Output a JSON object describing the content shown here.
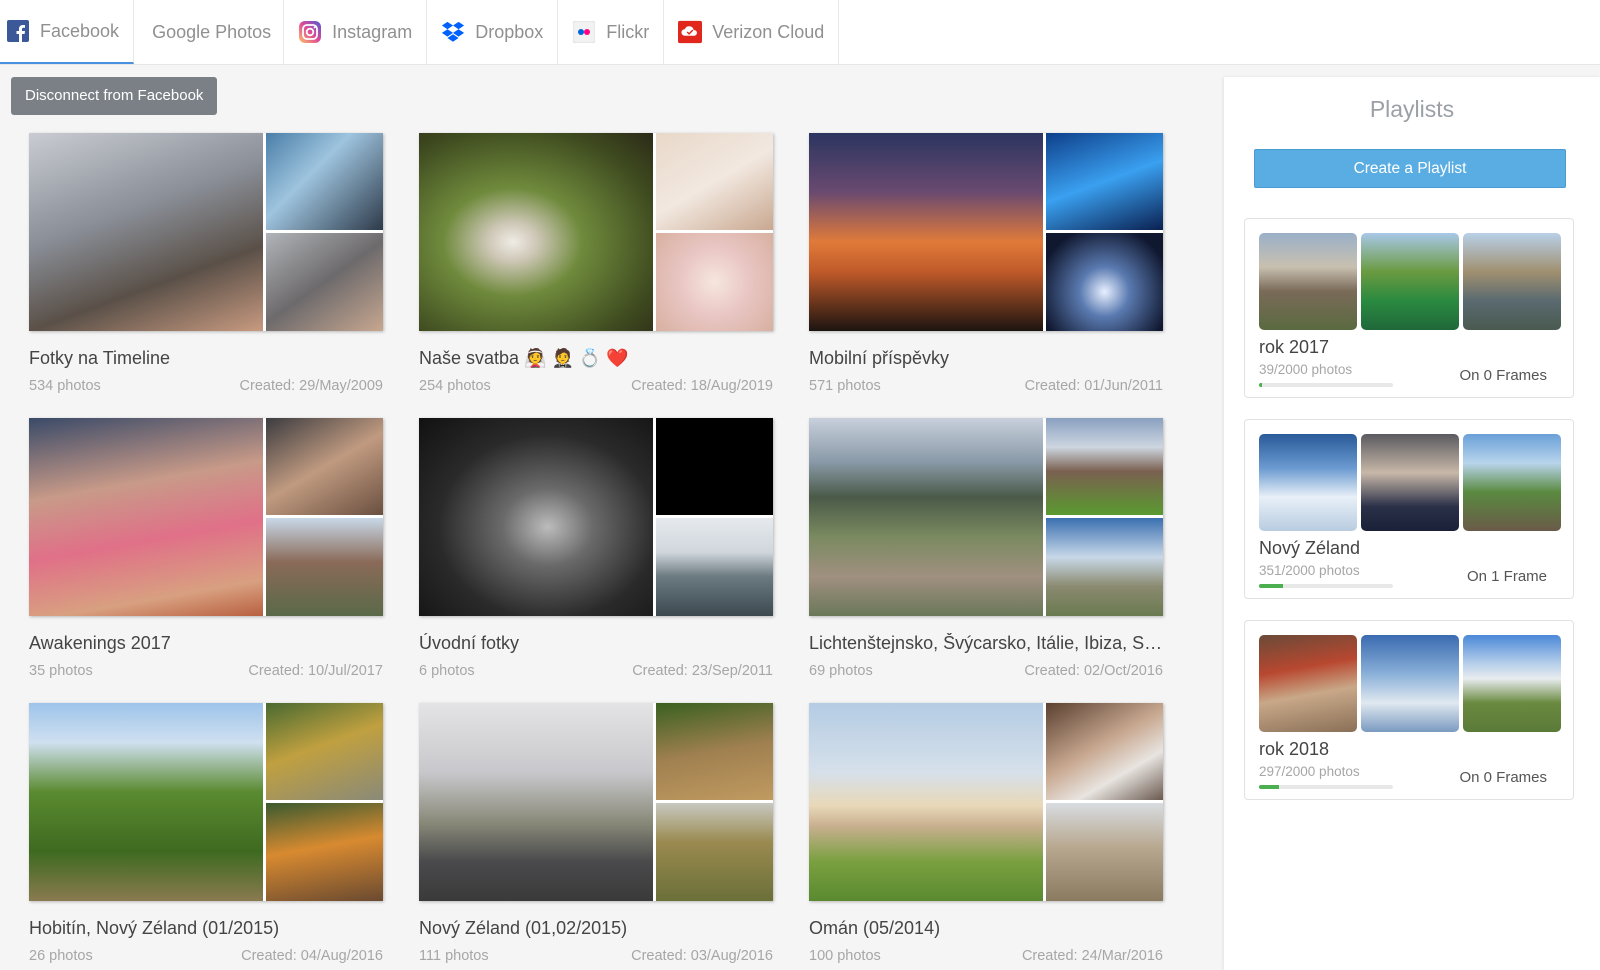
{
  "tabs": [
    {
      "label": "Facebook",
      "icon": "facebook-icon",
      "active": true
    },
    {
      "label": "Google Photos",
      "icon": "",
      "active": false
    },
    {
      "label": "Instagram",
      "icon": "instagram-icon",
      "active": false
    },
    {
      "label": "Dropbox",
      "icon": "dropbox-icon",
      "active": false
    },
    {
      "label": "Flickr",
      "icon": "flickr-icon",
      "active": false
    },
    {
      "label": "Verizon Cloud",
      "icon": "verizon-cloud-icon",
      "active": false
    }
  ],
  "disconnect_label": "Disconnect from Facebook",
  "albums": [
    {
      "title": "Fotky na Timeline",
      "count": "534 photos",
      "created": "Created: 29/May/2009"
    },
    {
      "title": "Naše svatba 👰 🤵 💍 ❤️",
      "count": "254 photos",
      "created": "Created: 18/Aug/2019"
    },
    {
      "title": "Mobilní příspěvky",
      "count": "571 photos",
      "created": "Created: 01/Jun/2011"
    },
    {
      "title": "Awakenings 2017",
      "count": "35 photos",
      "created": "Created: 10/Jul/2017"
    },
    {
      "title": "Úvodní fotky",
      "count": "6 photos",
      "created": "Created: 23/Sep/2011"
    },
    {
      "title": "Lichtenštejnsko, Švýcarsko, Itálie, Ibiza, St...",
      "count": "69 photos",
      "created": "Created: 02/Oct/2016"
    },
    {
      "title": "Hobitín, Nový Zéland (01/2015)",
      "count": "26 photos",
      "created": "Created: 04/Aug/2016"
    },
    {
      "title": "Nový Zéland (01,02/2015)",
      "count": "111 photos",
      "created": "Created: 03/Aug/2016"
    },
    {
      "title": "Omán (05/2014)",
      "count": "100 photos",
      "created": "Created: 24/Mar/2016"
    }
  ],
  "playlists": {
    "heading": "Playlists",
    "create_label": "Create a Playlist",
    "items": [
      {
        "name": "rok 2017",
        "count": "39/2000 photos",
        "frames": "On 0 Frames",
        "progress": 0.0195
      },
      {
        "name": "Nový Zéland",
        "count": "351/2000 photos",
        "frames": "On 1 Frame",
        "progress": 0.1755
      },
      {
        "name": "rok 2018",
        "count": "297/2000 photos",
        "frames": "On 0 Frames",
        "progress": 0.1485
      }
    ]
  },
  "colors": {
    "accent": "#4a90e2",
    "button_grey": "#7b8087",
    "create_blue": "#5aade2",
    "progress_green": "#4caf50"
  }
}
